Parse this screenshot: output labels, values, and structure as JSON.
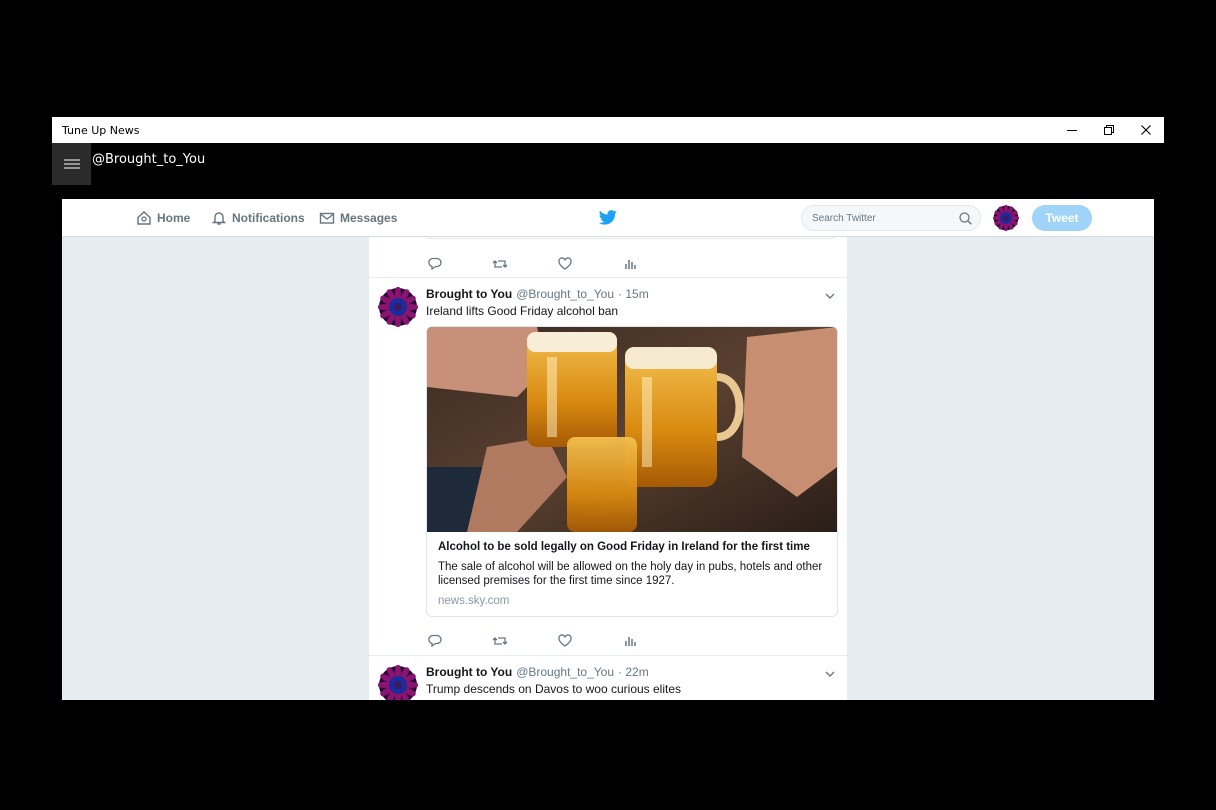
{
  "window": {
    "title": "Tune Up News",
    "account": "@Brought_to_You"
  },
  "nav": {
    "home": "Home",
    "notifications": "Notifications",
    "messages": "Messages",
    "search_placeholder": "Search Twitter",
    "tweet_button": "Tweet"
  },
  "colors": {
    "twitter_blue": "#1da1f2",
    "tweet_button": "#9fd3f7",
    "timeline_bg": "#e6ecf0"
  },
  "tweets": [
    {
      "name": "Brought to You",
      "handle": "@Brought_to_You",
      "time": "· 15m",
      "text": "Ireland lifts Good Friday alcohol ban",
      "card": {
        "title": "Alcohol to be sold legally on Good Friday in Ireland for the first time",
        "description": "The sale of alcohol will be allowed on the holy day in pubs, hotels and other licensed premises for the first time since 1927.",
        "domain": "news.sky.com"
      }
    },
    {
      "name": "Brought to You",
      "handle": "@Brought_to_You",
      "time": "· 22m",
      "text": "Trump descends on Davos to woo curious elites"
    }
  ]
}
